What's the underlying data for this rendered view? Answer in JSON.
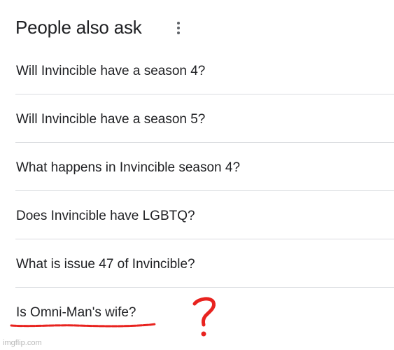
{
  "header": {
    "title": "People also ask",
    "more_icon": "more-vertical-icon"
  },
  "questions": [
    "Will Invincible have a season 4?",
    "Will Invincible have a season 5?",
    "What happens in Invincible season 4?",
    "Does Invincible have LGBTQ?",
    "What is issue 47 of Invincible?",
    "Is Omni-Man's wife?"
  ],
  "annotation": {
    "color": "#e8231f",
    "mark": "?"
  },
  "watermark": "imgflip.com"
}
